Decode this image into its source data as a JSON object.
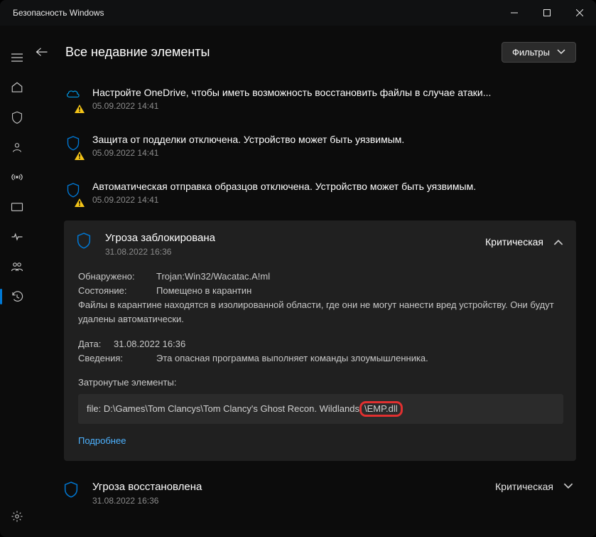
{
  "window": {
    "title": "Безопасность Windows"
  },
  "header": {
    "page_title": "Все недавние элементы",
    "filters_label": "Фильтры"
  },
  "notices": [
    {
      "title": "Настройте OneDrive, чтобы иметь возможность восстановить файлы в случае атаки...",
      "time": "05.09.2022 14:41"
    },
    {
      "title": "Защита от подделки отключена. Устройство может быть уязвимым.",
      "time": "05.09.2022 14:41"
    },
    {
      "title": "Автоматическая отправка образцов отключена. Устройство может быть уязвимым.",
      "time": "05.09.2022 14:41"
    }
  ],
  "threat": {
    "title": "Угроза заблокирована",
    "time": "31.08.2022 16:36",
    "severity": "Критическая",
    "detected_label": "Обнаружено:",
    "detected_value": "Trojan:Win32/Wacatac.A!ml",
    "state_label": "Состояние:",
    "state_value": "Помещено в карантин",
    "quarantine_note": "Файлы в карантине находятся в изолированной области, где они не могут нанести вред устройству. Они будут удалены автоматически.",
    "date_label": "Дата:",
    "date_value": "31.08.2022 16:36",
    "details_label": "Сведения:",
    "details_value": "Эта опасная программа выполняет команды злоумышленника.",
    "affected_label": "Затронутые элементы:",
    "affected_prefix": "file: D:\\Games\\Tom Clancys\\Tom Clancy's Ghost Recon. Wildlands",
    "affected_highlight": "\\EMP.dll",
    "more_link": "Подробнее"
  },
  "restored": {
    "title": "Угроза восстановлена",
    "time": "31.08.2022 16:36",
    "severity": "Критическая"
  }
}
